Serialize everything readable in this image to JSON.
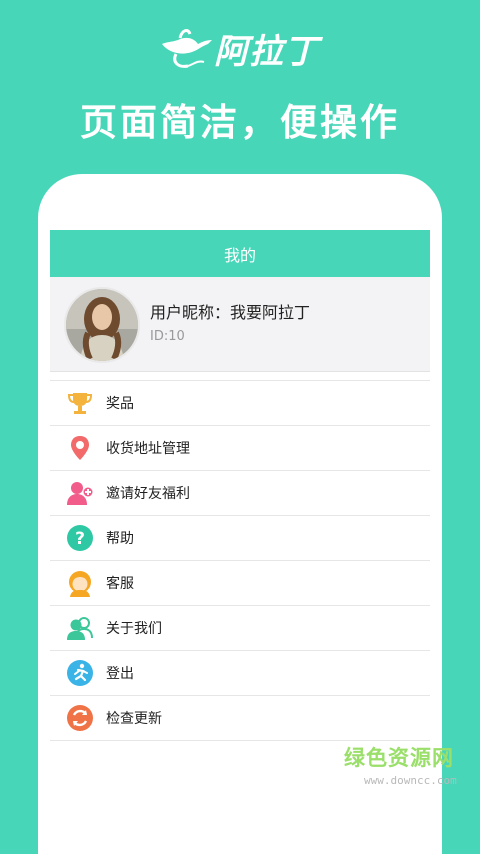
{
  "brand": {
    "name": "阿拉丁",
    "lamp_icon": "magic-lamp-icon"
  },
  "slogan": "页面简洁，便操作",
  "header": {
    "title": "我的"
  },
  "profile": {
    "nickname": "用户昵称：我要阿拉丁",
    "id": "ID:10"
  },
  "menu": [
    {
      "label": "奖品",
      "icon": "trophy-icon",
      "color": "#f3b33d"
    },
    {
      "label": "收货地址管理",
      "icon": "location-pin-icon",
      "color": "#f26a6a"
    },
    {
      "label": "邀请好友福利",
      "icon": "invite-friend-icon",
      "color": "#f15c8a"
    },
    {
      "label": "帮助",
      "icon": "help-icon",
      "color": "#2ec9a4"
    },
    {
      "label": "客服",
      "icon": "customer-service-icon",
      "color": "#f5a623"
    },
    {
      "label": "关于我们",
      "icon": "about-us-icon",
      "color": "#3cc79a"
    },
    {
      "label": "登出",
      "icon": "logout-icon",
      "color": "#3ab3e6"
    },
    {
      "label": "检查更新",
      "icon": "refresh-icon",
      "color": "#f07347"
    }
  ],
  "watermark": {
    "title": "绿色资源网",
    "url": "www.downcc.com"
  },
  "colors": {
    "accent": "#48d6b9",
    "profile_bg": "#f3f2f4"
  }
}
